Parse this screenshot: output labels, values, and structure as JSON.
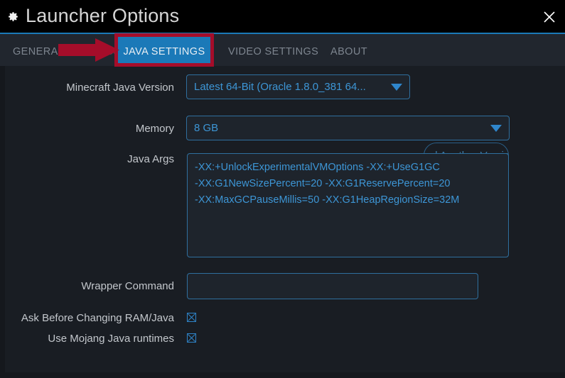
{
  "window": {
    "title": "Launcher Options",
    "gear_icon": "gear-icon",
    "close_icon": "close-icon"
  },
  "tabs": [
    {
      "label": "GENERAL SETTINGS",
      "active": false
    },
    {
      "label": "JAVA SETTINGS",
      "active": true
    },
    {
      "label": "VIDEO SETTINGS",
      "active": false
    },
    {
      "label": "ABOUT",
      "active": false
    }
  ],
  "form": {
    "java_version": {
      "label": "Minecraft Java Version",
      "value": "Latest 64-Bit (Oracle 1.8.0_381 64...",
      "caret_icon": "chevron-down-icon"
    },
    "find_version_button": {
      "label": "Find Another Version"
    },
    "memory": {
      "label": "Memory",
      "value": "8 GB",
      "caret_icon": "chevron-down-icon"
    },
    "java_args": {
      "label": "Java Args",
      "lines": [
        "-XX:+UnlockExperimentalVMOptions -XX:+UseG1GC",
        "-XX:G1NewSizePercent=20 -XX:G1ReservePercent=20",
        "-XX:MaxGCPauseMillis=50 -XX:G1HeapRegionSize=32M"
      ]
    },
    "wrapper_command": {
      "label": "Wrapper Command",
      "value": "",
      "placeholder": ""
    },
    "checkboxes": [
      {
        "label": "Ask Before Changing RAM/Java",
        "checked": true,
        "icon": "checkbox-x-icon"
      },
      {
        "label": "Use Mojang Java runtimes",
        "checked": true,
        "icon": "checkbox-x-icon"
      }
    ]
  },
  "annotations": {
    "arrow_icon": "red-arrow-right-icon",
    "highlight_color": "#a50d2a",
    "target": "JAVA SETTINGS"
  },
  "colors": {
    "accent_blue": "#1b79b8",
    "field_text": "#3d96d6",
    "window_bg": "#191d23",
    "titlebar_bg": "#000000",
    "tabbar_bg": "#21262e",
    "annotation_red": "#a50d2a"
  }
}
